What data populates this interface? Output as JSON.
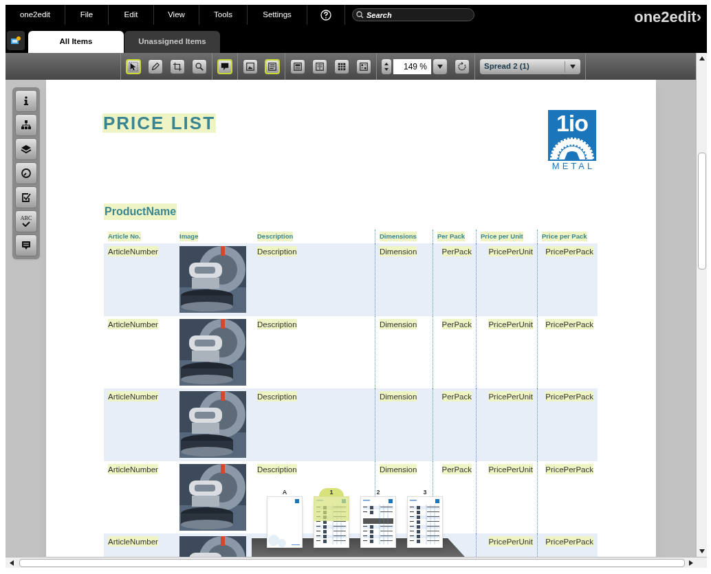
{
  "menu_bar": {
    "items": [
      "one2edit",
      "File",
      "Edit",
      "View",
      "Tools",
      "Settings"
    ],
    "search": {
      "placeholder": "Search"
    },
    "brand": "one2edit›"
  },
  "tabs": [
    {
      "label": "All Items",
      "selected": true
    },
    {
      "label": "Unassigned Items",
      "selected": false
    }
  ],
  "toolbar": {
    "tool_groups": [
      [
        {
          "selected": true
        },
        {
          "selected": false
        },
        {
          "selected": false
        },
        {
          "selected": false
        }
      ],
      [
        {
          "selected": true
        }
      ],
      [
        {
          "selected": false
        },
        {
          "selected": true
        }
      ],
      [
        {
          "selected": false
        },
        {
          "selected": false
        },
        {
          "selected": false
        },
        {
          "selected": false
        }
      ]
    ],
    "zoom": "149 %",
    "spread": "Spread 2 (1)"
  },
  "sidebar": {
    "tools": [
      {
        "kind": "info"
      },
      {
        "kind": "structure"
      },
      {
        "kind": "layers"
      },
      {
        "kind": "history"
      },
      {
        "kind": "tasks"
      },
      {
        "kind": "spellcheck",
        "label": "ABC"
      },
      {
        "kind": "comments"
      }
    ]
  },
  "document": {
    "title": "PRICE LIST",
    "logo": {
      "mark": "1io",
      "caption": "METAL"
    },
    "product_name": "ProductName",
    "columns": [
      "Article No.",
      "Image",
      "Description",
      "Dimensions",
      "Per Pack",
      "Price per Unit",
      "Price per Pack"
    ],
    "rows": [
      {
        "article": "ArticleNumber",
        "description": "Description",
        "dimension": "Dimension",
        "per_pack": "PerPack",
        "price_per_unit": "PricePerUnit",
        "price_per_pack": "PricePerPack"
      },
      {
        "article": "ArticleNumber",
        "description": "Description",
        "dimension": "Dimension",
        "per_pack": "PerPack",
        "price_per_unit": "PricePerUnit",
        "price_per_pack": "PricePerPack"
      },
      {
        "article": "ArticleNumber",
        "description": "Description",
        "dimension": "Dimension",
        "per_pack": "PerPack",
        "price_per_unit": "PricePerUnit",
        "price_per_pack": "PricePerPack"
      },
      {
        "article": "ArticleNumber",
        "description": "Description",
        "dimension": "Dimension",
        "per_pack": "PerPack",
        "price_per_unit": "PricePerUnit",
        "price_per_pack": "PricePerPack"
      },
      {
        "article": "ArticleNumber",
        "price_per_unit": "PricePerUnit",
        "price_per_pack": "PricePerPack"
      }
    ]
  },
  "page_navigator": {
    "pages": [
      {
        "label": "A",
        "kind": "master",
        "selected": false
      },
      {
        "label": "1",
        "kind": "table",
        "selected": true
      },
      {
        "label": "2",
        "kind": "banner",
        "selected": false
      },
      {
        "label": "3",
        "kind": "table",
        "selected": false
      }
    ]
  }
}
